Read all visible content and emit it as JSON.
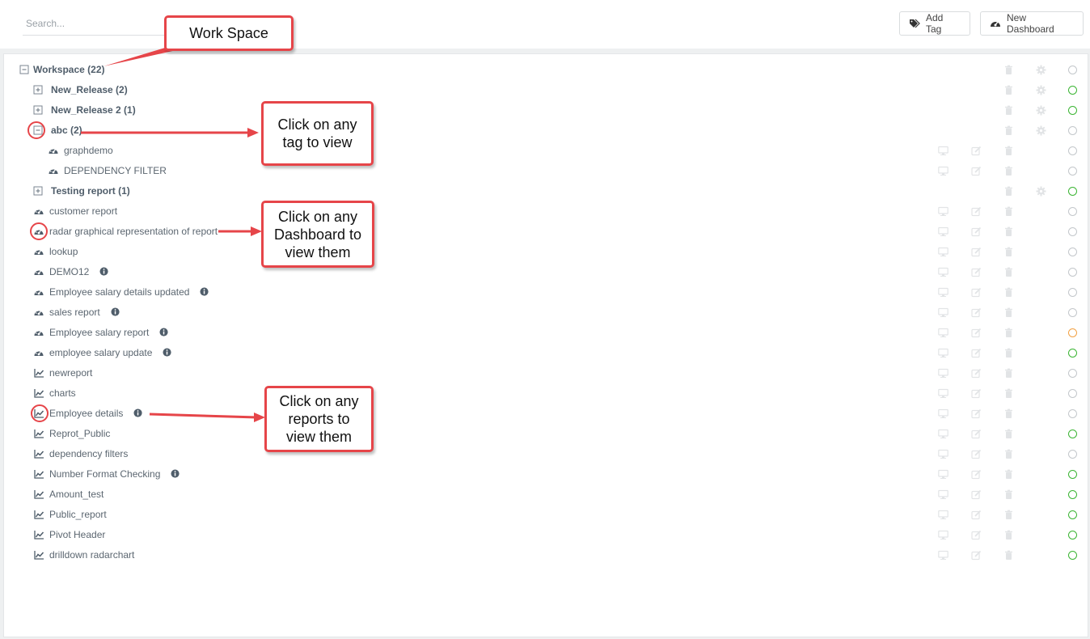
{
  "search": {
    "placeholder": "Search..."
  },
  "toolbar": {
    "add_tag_label": "Add Tag",
    "new_dashboard_label": "New Dashboard"
  },
  "colors": {
    "status_green": "#3bb533",
    "status_orange": "#f2a144",
    "status_grey": "#c3c7cb",
    "annotation_red": "#e64549"
  },
  "tree": {
    "rows": [
      {
        "label": "Workspace (22)",
        "icon": "minus-square-icon",
        "level": "root",
        "status": "grey",
        "actions": [
          "trash-icon",
          "gear-icon"
        ]
      },
      {
        "label": "New_Release (2)",
        "icon": "plus-square-icon",
        "level": "tag",
        "status": "green",
        "actions": [
          "trash-icon",
          "gear-icon"
        ]
      },
      {
        "label": "New_Release 2 (1)",
        "icon": "plus-square-icon",
        "level": "tag",
        "status": "green",
        "actions": [
          "trash-icon",
          "gear-icon"
        ]
      },
      {
        "label": "abc (2)",
        "icon": "minus-square-icon",
        "level": "tag",
        "status": "grey",
        "actions": [
          "trash-icon",
          "gear-icon"
        ]
      },
      {
        "label": "graphdemo",
        "icon": "dashboard-icon",
        "level": "child",
        "status": "grey",
        "actions": [
          "monitor-icon",
          "edit-icon",
          "trash-icon"
        ]
      },
      {
        "label": "DEPENDENCY FILTER",
        "icon": "dashboard-icon",
        "level": "child",
        "status": "grey",
        "actions": [
          "monitor-icon",
          "edit-icon",
          "trash-icon"
        ]
      },
      {
        "label": "Testing report (1)",
        "icon": "plus-square-icon",
        "level": "tag",
        "status": "green",
        "actions": [
          "trash-icon",
          "gear-icon"
        ]
      },
      {
        "label": "customer report",
        "icon": "dashboard-icon",
        "level": "item",
        "status": "grey",
        "actions": [
          "monitor-icon",
          "edit-icon",
          "trash-icon"
        ]
      },
      {
        "label": "radar graphical representation of report",
        "icon": "dashboard-icon",
        "level": "item",
        "status": "grey",
        "actions": [
          "monitor-icon",
          "edit-icon",
          "trash-icon"
        ]
      },
      {
        "label": "lookup",
        "icon": "dashboard-icon",
        "level": "item",
        "status": "grey",
        "actions": [
          "monitor-icon",
          "edit-icon",
          "trash-icon"
        ]
      },
      {
        "label": "DEMO12",
        "icon": "dashboard-icon",
        "level": "item",
        "status": "grey",
        "info": true,
        "actions": [
          "monitor-icon",
          "edit-icon",
          "trash-icon"
        ]
      },
      {
        "label": "Employee salary details updated",
        "icon": "dashboard-icon",
        "level": "item",
        "status": "grey",
        "info": true,
        "actions": [
          "monitor-icon",
          "edit-icon",
          "trash-icon"
        ]
      },
      {
        "label": "sales report",
        "icon": "dashboard-icon",
        "level": "item",
        "status": "grey",
        "info": true,
        "actions": [
          "monitor-icon",
          "edit-icon",
          "trash-icon"
        ]
      },
      {
        "label": "Employee salary report",
        "icon": "dashboard-icon",
        "level": "item",
        "status": "orange",
        "info": true,
        "actions": [
          "monitor-icon",
          "edit-icon",
          "trash-icon"
        ]
      },
      {
        "label": "employee salary update",
        "icon": "dashboard-icon",
        "level": "item",
        "status": "green",
        "info": true,
        "actions": [
          "monitor-icon",
          "edit-icon",
          "trash-icon"
        ]
      },
      {
        "label": "newreport",
        "icon": "chart-line-icon",
        "level": "item",
        "status": "grey",
        "actions": [
          "monitor-icon",
          "edit-icon",
          "trash-icon"
        ]
      },
      {
        "label": "charts",
        "icon": "chart-line-icon",
        "level": "item",
        "status": "grey",
        "actions": [
          "monitor-icon",
          "edit-icon",
          "trash-icon"
        ]
      },
      {
        "label": "Employee details",
        "icon": "chart-line-icon",
        "level": "item",
        "status": "grey",
        "info": true,
        "actions": [
          "monitor-icon",
          "edit-icon",
          "trash-icon"
        ]
      },
      {
        "label": "Reprot_Public",
        "icon": "chart-line-icon",
        "level": "item",
        "status": "green",
        "actions": [
          "monitor-icon",
          "edit-icon",
          "trash-icon"
        ]
      },
      {
        "label": "dependency filters",
        "icon": "chart-line-icon",
        "level": "item",
        "status": "grey",
        "actions": [
          "monitor-icon",
          "edit-icon",
          "trash-icon"
        ]
      },
      {
        "label": "Number Format Checking",
        "icon": "chart-line-icon",
        "level": "item",
        "status": "green",
        "info": true,
        "actions": [
          "monitor-icon",
          "edit-icon",
          "trash-icon"
        ]
      },
      {
        "label": "Amount_test",
        "icon": "chart-line-icon",
        "level": "item",
        "status": "green",
        "actions": [
          "monitor-icon",
          "edit-icon",
          "trash-icon"
        ]
      },
      {
        "label": "Public_report",
        "icon": "chart-line-icon",
        "level": "item",
        "status": "green",
        "actions": [
          "monitor-icon",
          "edit-icon",
          "trash-icon"
        ]
      },
      {
        "label": "Pivot Header",
        "icon": "chart-line-icon",
        "level": "item",
        "status": "green",
        "actions": [
          "monitor-icon",
          "edit-icon",
          "trash-icon"
        ]
      },
      {
        "label": "drilldown radarchart",
        "icon": "chart-line-icon",
        "level": "item",
        "status": "green",
        "actions": [
          "monitor-icon",
          "edit-icon",
          "trash-icon"
        ]
      }
    ]
  },
  "annotations": {
    "workspace": "Work Space",
    "tag": "Click on any tag to view",
    "dashboard": "Click on any Dashboard to view them",
    "reports": "Click on any reports to view them"
  }
}
